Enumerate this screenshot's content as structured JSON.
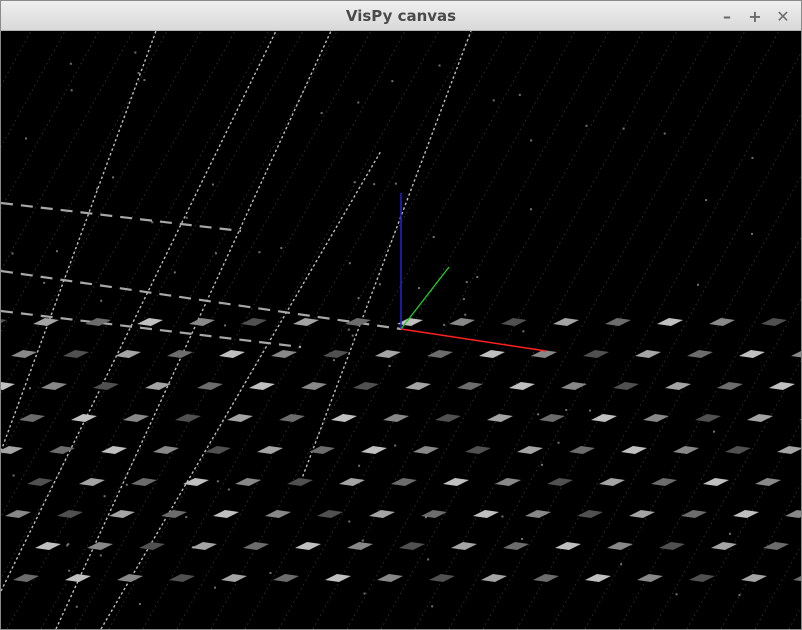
{
  "window": {
    "title": "VisPy canvas",
    "controls": {
      "minimize": "–",
      "maximize": "+",
      "close": "✕"
    }
  },
  "scene": {
    "background": "#000000",
    "point_color": "#d0d0d0",
    "axes": {
      "x_color": "#ff2020",
      "y_color": "#20d020",
      "z_color": "#2020d0"
    }
  }
}
